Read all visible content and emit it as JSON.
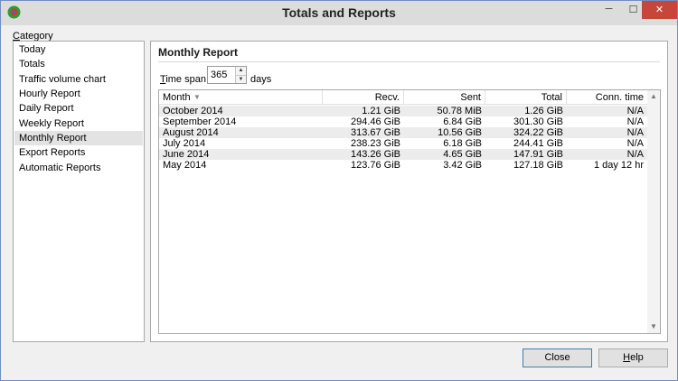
{
  "window": {
    "title": "Totals and Reports",
    "minimize_glyph": "─",
    "maximize_glyph": "☐",
    "close_glyph": "✕"
  },
  "category": {
    "label_underlined": "C",
    "label_rest": "ategory",
    "items": [
      {
        "label": "Today",
        "selected": false
      },
      {
        "label": "Totals",
        "selected": false
      },
      {
        "label": "Traffic volume chart",
        "selected": false
      },
      {
        "label": "Hourly Report",
        "selected": false
      },
      {
        "label": "Daily Report",
        "selected": false
      },
      {
        "label": "Weekly Report",
        "selected": false
      },
      {
        "label": "Monthly Report",
        "selected": true
      },
      {
        "label": "Export Reports",
        "selected": false
      },
      {
        "label": "Automatic Reports",
        "selected": false
      }
    ]
  },
  "report": {
    "title": "Monthly Report",
    "timespan_label_underlined": "T",
    "timespan_label_rest": "ime span:",
    "timespan_value": "365",
    "days_label": "days",
    "spin_up_glyph": "▲",
    "spin_down_glyph": "▼",
    "sort_glyph": "▼",
    "scroll_up_glyph": "▲",
    "scroll_down_glyph": "▼",
    "columns": [
      "Month",
      "Recv.",
      "Sent",
      "Total",
      "Conn. time"
    ],
    "rows": [
      {
        "month": "October 2014",
        "recv": "1.21 GiB",
        "sent": "50.78 MiB",
        "total": "1.26 GiB",
        "conn": "N/A"
      },
      {
        "month": "September 2014",
        "recv": "294.46 GiB",
        "sent": "6.84 GiB",
        "total": "301.30 GiB",
        "conn": "N/A"
      },
      {
        "month": "August 2014",
        "recv": "313.67 GiB",
        "sent": "10.56 GiB",
        "total": "324.22 GiB",
        "conn": "N/A"
      },
      {
        "month": "July 2014",
        "recv": "238.23 GiB",
        "sent": "6.18 GiB",
        "total": "244.41 GiB",
        "conn": "N/A"
      },
      {
        "month": "June 2014",
        "recv": "143.26 GiB",
        "sent": "4.65 GiB",
        "total": "147.91 GiB",
        "conn": "N/A"
      },
      {
        "month": "May 2014",
        "recv": "123.76 GiB",
        "sent": "3.42 GiB",
        "total": "127.18 GiB",
        "conn": "1 day 12 hr"
      }
    ]
  },
  "buttons": {
    "close": "Close",
    "help_underlined": "H",
    "help_rest": "elp"
  }
}
